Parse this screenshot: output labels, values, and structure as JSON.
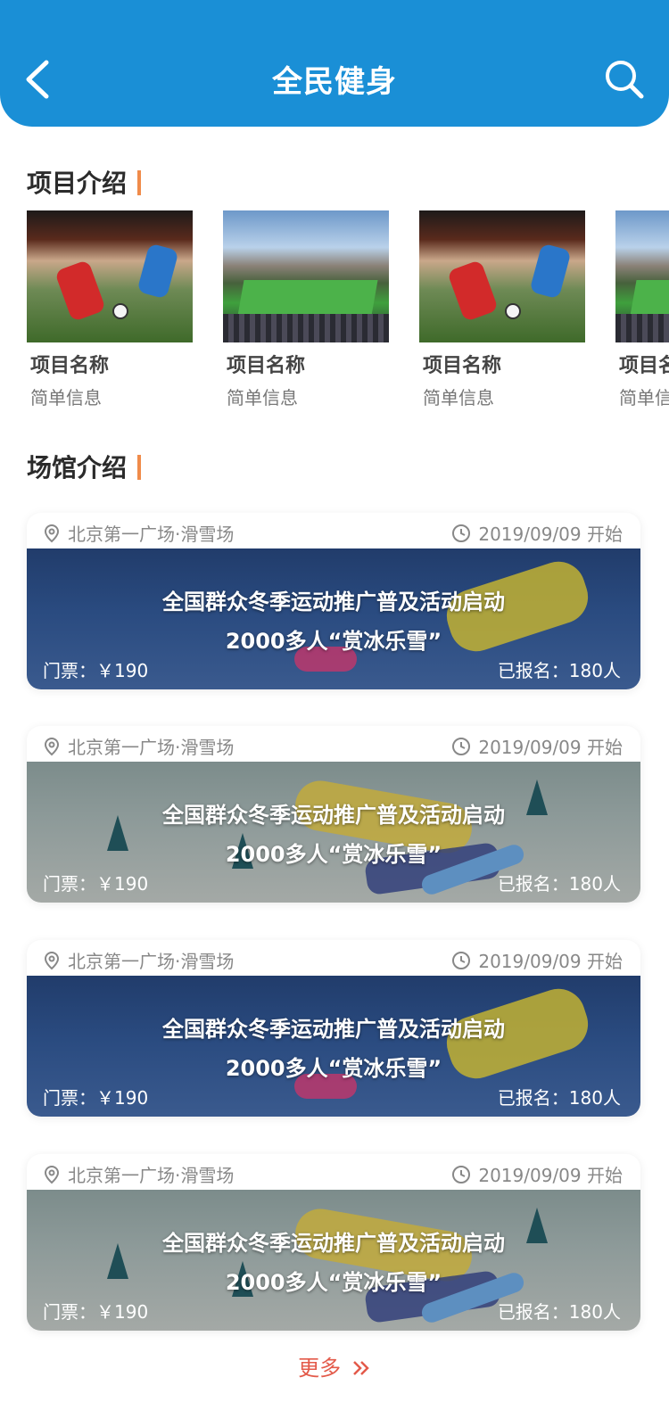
{
  "header": {
    "title": "全民健身",
    "back_icon": "chevron-left-icon",
    "search_icon": "search-icon",
    "background": "#1a8fd6"
  },
  "projects_section": {
    "title": "项目介绍",
    "items": [
      {
        "name": "项目名称",
        "info": "简单信息",
        "image": "football-kick"
      },
      {
        "name": "项目名称",
        "info": "简单信息",
        "image": "stadium"
      },
      {
        "name": "项目名称",
        "info": "简单信息",
        "image": "football-kick"
      },
      {
        "name": "项目名称",
        "info": "简单信息",
        "image": "stadium"
      }
    ]
  },
  "venues_section": {
    "title": "场馆介绍",
    "cards": [
      {
        "location": "北京第一广场·滑雪场",
        "date": "2019/09/09 开始",
        "headline_1": "全国群众冬季运动推广普及活动启动",
        "headline_2": "2000多人“赏冰乐雪”",
        "ticket": "门票：￥190",
        "signed_up": "已报名：180人",
        "banner": "night"
      },
      {
        "location": "北京第一广场·滑雪场",
        "date": "2019/09/09 开始",
        "headline_1": "全国群众冬季运动推广普及活动启动",
        "headline_2": "2000多人“赏冰乐雪”",
        "ticket": "门票：￥190",
        "signed_up": "已报名：180人",
        "banner": "snow"
      },
      {
        "location": "北京第一广场·滑雪场",
        "date": "2019/09/09 开始",
        "headline_1": "全国群众冬季运动推广普及活动启动",
        "headline_2": "2000多人“赏冰乐雪”",
        "ticket": "门票：￥190",
        "signed_up": "已报名：180人",
        "banner": "night"
      },
      {
        "location": "北京第一广场·滑雪场",
        "date": "2019/09/09 开始",
        "headline_1": "全国群众冬季运动推广普及活动启动",
        "headline_2": "2000多人“赏冰乐雪”",
        "ticket": "门票：￥190",
        "signed_up": "已报名：180人",
        "banner": "snow"
      }
    ]
  },
  "more": {
    "label": "更多",
    "icon": "double-chevron-right-icon",
    "color": "#e35a4a"
  },
  "accent": "#f08b4a"
}
